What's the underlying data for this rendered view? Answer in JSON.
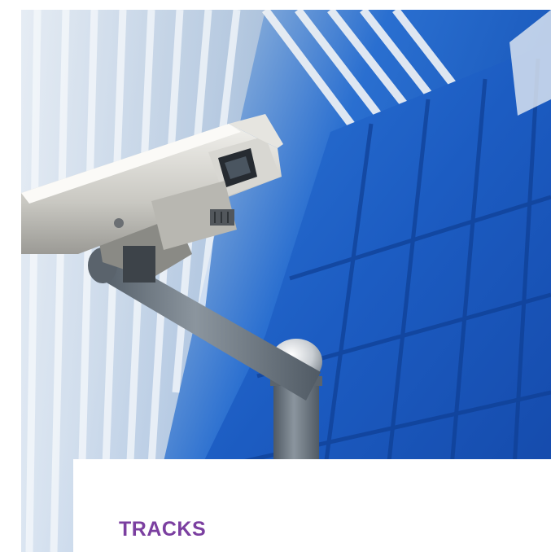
{
  "article_card": {
    "image": {
      "subject": "security-camera-on-pole",
      "colors": {
        "sky_blue": "#1f63c8",
        "building_light": "#c9d6e6",
        "pole_gray": "#6f7982"
      }
    },
    "category": "TRACKS",
    "headline": "",
    "colors": {
      "category": "#7b3fa0",
      "headline": "#2b2b2b",
      "caption_bg": "#ffffff"
    }
  }
}
